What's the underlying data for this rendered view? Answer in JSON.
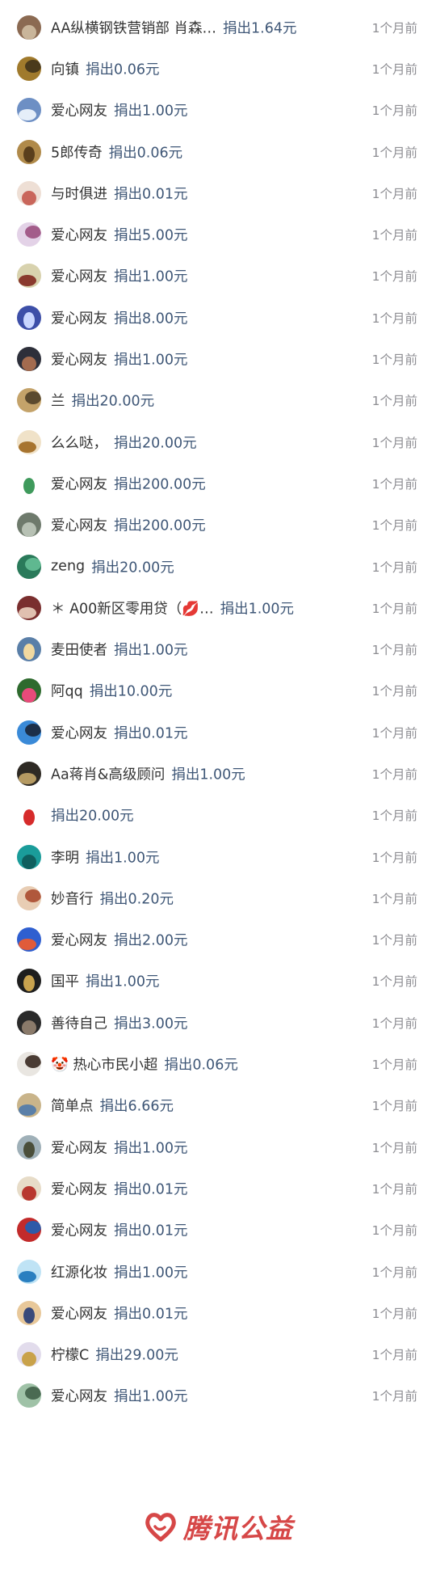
{
  "donations": [
    {
      "name": "AA纵横钢铁营销部 肖森…",
      "amount": "捐出1.64元",
      "time": "1个月前",
      "avatar_color": "#8b6a52",
      "avatar_accent": "#c9b59a"
    },
    {
      "name": "向镇",
      "amount": "捐出0.06元",
      "time": "1个月前",
      "avatar_color": "#a07a2c",
      "avatar_accent": "#4a3a1c"
    },
    {
      "name": "爱心网友",
      "amount": "捐出1.00元",
      "time": "1个月前",
      "avatar_color": "#6d8fc4",
      "avatar_accent": "#e5eef9"
    },
    {
      "name": "5郎传奇",
      "amount": "捐出0.06元",
      "time": "1个月前",
      "avatar_color": "#b08a4a",
      "avatar_accent": "#5a3f1c"
    },
    {
      "name": "与时俱进",
      "amount": "捐出0.01元",
      "time": "1个月前",
      "avatar_color": "#eedfd5",
      "avatar_accent": "#c9665b"
    },
    {
      "name": "爱心网友",
      "amount": "捐出5.00元",
      "time": "1个月前",
      "avatar_color": "#e3d2e7",
      "avatar_accent": "#a35c8a"
    },
    {
      "name": "爱心网友",
      "amount": "捐出1.00元",
      "time": "1个月前",
      "avatar_color": "#d8d2ae",
      "avatar_accent": "#8a3a2e"
    },
    {
      "name": "爱心网友",
      "amount": "捐出8.00元",
      "time": "1个月前",
      "avatar_color": "#3d4fa8",
      "avatar_accent": "#c9d6ff"
    },
    {
      "name": "爱心网友",
      "amount": "捐出1.00元",
      "time": "1个月前",
      "avatar_color": "#2d2f3a",
      "avatar_accent": "#a36b4f"
    },
    {
      "name": "兰",
      "amount": "捐出20.00元",
      "time": "1个月前",
      "avatar_color": "#c4a36a",
      "avatar_accent": "#5b4a2e"
    },
    {
      "name": "么么哒，",
      "amount": "捐出20.00元",
      "time": "1个月前",
      "avatar_color": "#f0e2c8",
      "avatar_accent": "#a7742f"
    },
    {
      "name": "爱心网友",
      "amount": "捐出200.00元",
      "time": "1个月前",
      "avatar_color": "#ffffff",
      "avatar_accent": "#3f9a5c"
    },
    {
      "name": "爱心网友",
      "amount": "捐出200.00元",
      "time": "1个月前",
      "avatar_color": "#6e7a6c",
      "avatar_accent": "#b7c1b4"
    },
    {
      "name": "zeng",
      "amount": "捐出20.00元",
      "time": "1个月前",
      "avatar_color": "#2a7a5a",
      "avatar_accent": "#5fb890"
    },
    {
      "name": "＊ A00新区零用贷（💋…",
      "amount": "捐出1.00元",
      "time": "1个月前",
      "avatar_color": "#7a2e2e",
      "avatar_accent": "#e0c0b0"
    },
    {
      "name": "麦田使者",
      "amount": "捐出1.00元",
      "time": "1个月前",
      "avatar_color": "#5a7fa8",
      "avatar_accent": "#f1d9a0"
    },
    {
      "name": "阿qq",
      "amount": "捐出10.00元",
      "time": "1个月前",
      "avatar_color": "#2e6a2e",
      "avatar_accent": "#e84a7a"
    },
    {
      "name": "爱心网友",
      "amount": "捐出0.01元",
      "time": "1个月前",
      "avatar_color": "#3a8ad8",
      "avatar_accent": "#1c2f4a"
    },
    {
      "name": "Aa蒋肖&高级顾问",
      "amount": "捐出1.00元",
      "time": "1个月前",
      "avatar_color": "#2e2a24",
      "avatar_accent": "#b59a62"
    },
    {
      "name": "",
      "amount": "捐出20.00元",
      "time": "1个月前",
      "avatar_color": "#ffffff",
      "avatar_accent": "#d62b2b"
    },
    {
      "name": "李明",
      "amount": "捐出1.00元",
      "time": "1个月前",
      "avatar_color": "#1a9c9a",
      "avatar_accent": "#0e5f5e"
    },
    {
      "name": "妙音行",
      "amount": "捐出0.20元",
      "time": "1个月前",
      "avatar_color": "#e8cdb4",
      "avatar_accent": "#b0583c"
    },
    {
      "name": "爱心网友",
      "amount": "捐出2.00元",
      "time": "1个月前",
      "avatar_color": "#2f5fd0",
      "avatar_accent": "#e05b3a"
    },
    {
      "name": "国平",
      "amount": "捐出1.00元",
      "time": "1个月前",
      "avatar_color": "#1e1e1e",
      "avatar_accent": "#c8a24e"
    },
    {
      "name": "善待自己",
      "amount": "捐出3.00元",
      "time": "1个月前",
      "avatar_color": "#2a2a2a",
      "avatar_accent": "#8a7a6a"
    },
    {
      "name": "🤡 热心市民小超",
      "amount": "捐出0.06元",
      "time": "1个月前",
      "avatar_color": "#e9e6e1",
      "avatar_accent": "#4a3c34"
    },
    {
      "name": "简单点",
      "amount": "捐出6.66元",
      "time": "1个月前",
      "avatar_color": "#c9b48a",
      "avatar_accent": "#5a7fa8"
    },
    {
      "name": "爱心网友",
      "amount": "捐出1.00元",
      "time": "1个月前",
      "avatar_color": "#9fb0b8",
      "avatar_accent": "#4a4e3a"
    },
    {
      "name": "爱心网友",
      "amount": "捐出0.01元",
      "time": "1个月前",
      "avatar_color": "#e7dcc8",
      "avatar_accent": "#b8382f"
    },
    {
      "name": "爱心网友",
      "amount": "捐出0.01元",
      "time": "1个月前",
      "avatar_color": "#c22b2b",
      "avatar_accent": "#2d5aa8"
    },
    {
      "name": "红源化妆",
      "amount": "捐出1.00元",
      "time": "1个月前",
      "avatar_color": "#bfe3f5",
      "avatar_accent": "#2a7fc0"
    },
    {
      "name": "爱心网友",
      "amount": "捐出0.01元",
      "time": "1个月前",
      "avatar_color": "#e8c89a",
      "avatar_accent": "#3a4a7a"
    },
    {
      "name": "柠檬C",
      "amount": "捐出29.00元",
      "time": "1个月前",
      "avatar_color": "#e2dcec",
      "avatar_accent": "#c9a24a"
    },
    {
      "name": "爱心网友",
      "amount": "捐出1.00元",
      "time": "1个月前",
      "avatar_color": "#9fc2a7",
      "avatar_accent": "#4a6a52"
    }
  ],
  "footer": {
    "brand": "腾讯公益",
    "brand_color": "#d64747",
    "logo_icon": "heart-hands-icon"
  }
}
